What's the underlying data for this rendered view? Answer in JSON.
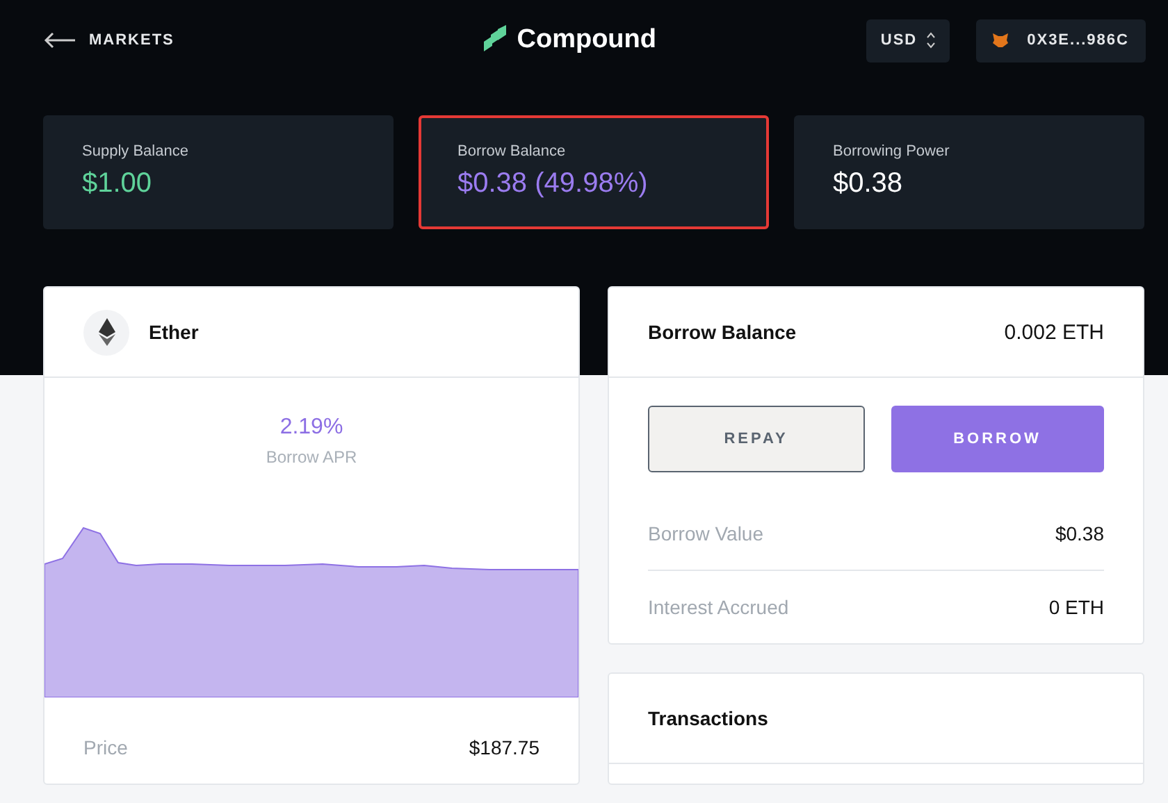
{
  "nav": {
    "back_label": "MARKETS",
    "brand": "Compound",
    "currency": "USD",
    "wallet": "0X3E...986C"
  },
  "stats": [
    {
      "label": "Supply Balance",
      "value": "$1.00",
      "color": "#5fd39a",
      "highlighted": false
    },
    {
      "label": "Borrow Balance",
      "value": "$0.38 (49.98%)",
      "color": "#9b7cf0",
      "highlighted": true
    },
    {
      "label": "Borrowing Power",
      "value": "$0.38",
      "color": "#ffffff",
      "highlighted": false
    }
  ],
  "market": {
    "name": "Ether",
    "rate": "2.19%",
    "rate_label": "Borrow APR",
    "rows": [
      {
        "label": "Price",
        "value": "$187.75"
      }
    ]
  },
  "borrow_panel": {
    "title": "Borrow Balance",
    "amount": "0.002 ETH",
    "buttons": [
      {
        "label": "REPAY",
        "kind": "outline"
      },
      {
        "label": "BORROW",
        "kind": "primary"
      }
    ],
    "rows": [
      {
        "label": "Borrow Value",
        "value": "$0.38"
      },
      {
        "label": "Interest Accrued",
        "value": "0 ETH"
      }
    ]
  },
  "transactions": {
    "title": "Transactions"
  }
}
